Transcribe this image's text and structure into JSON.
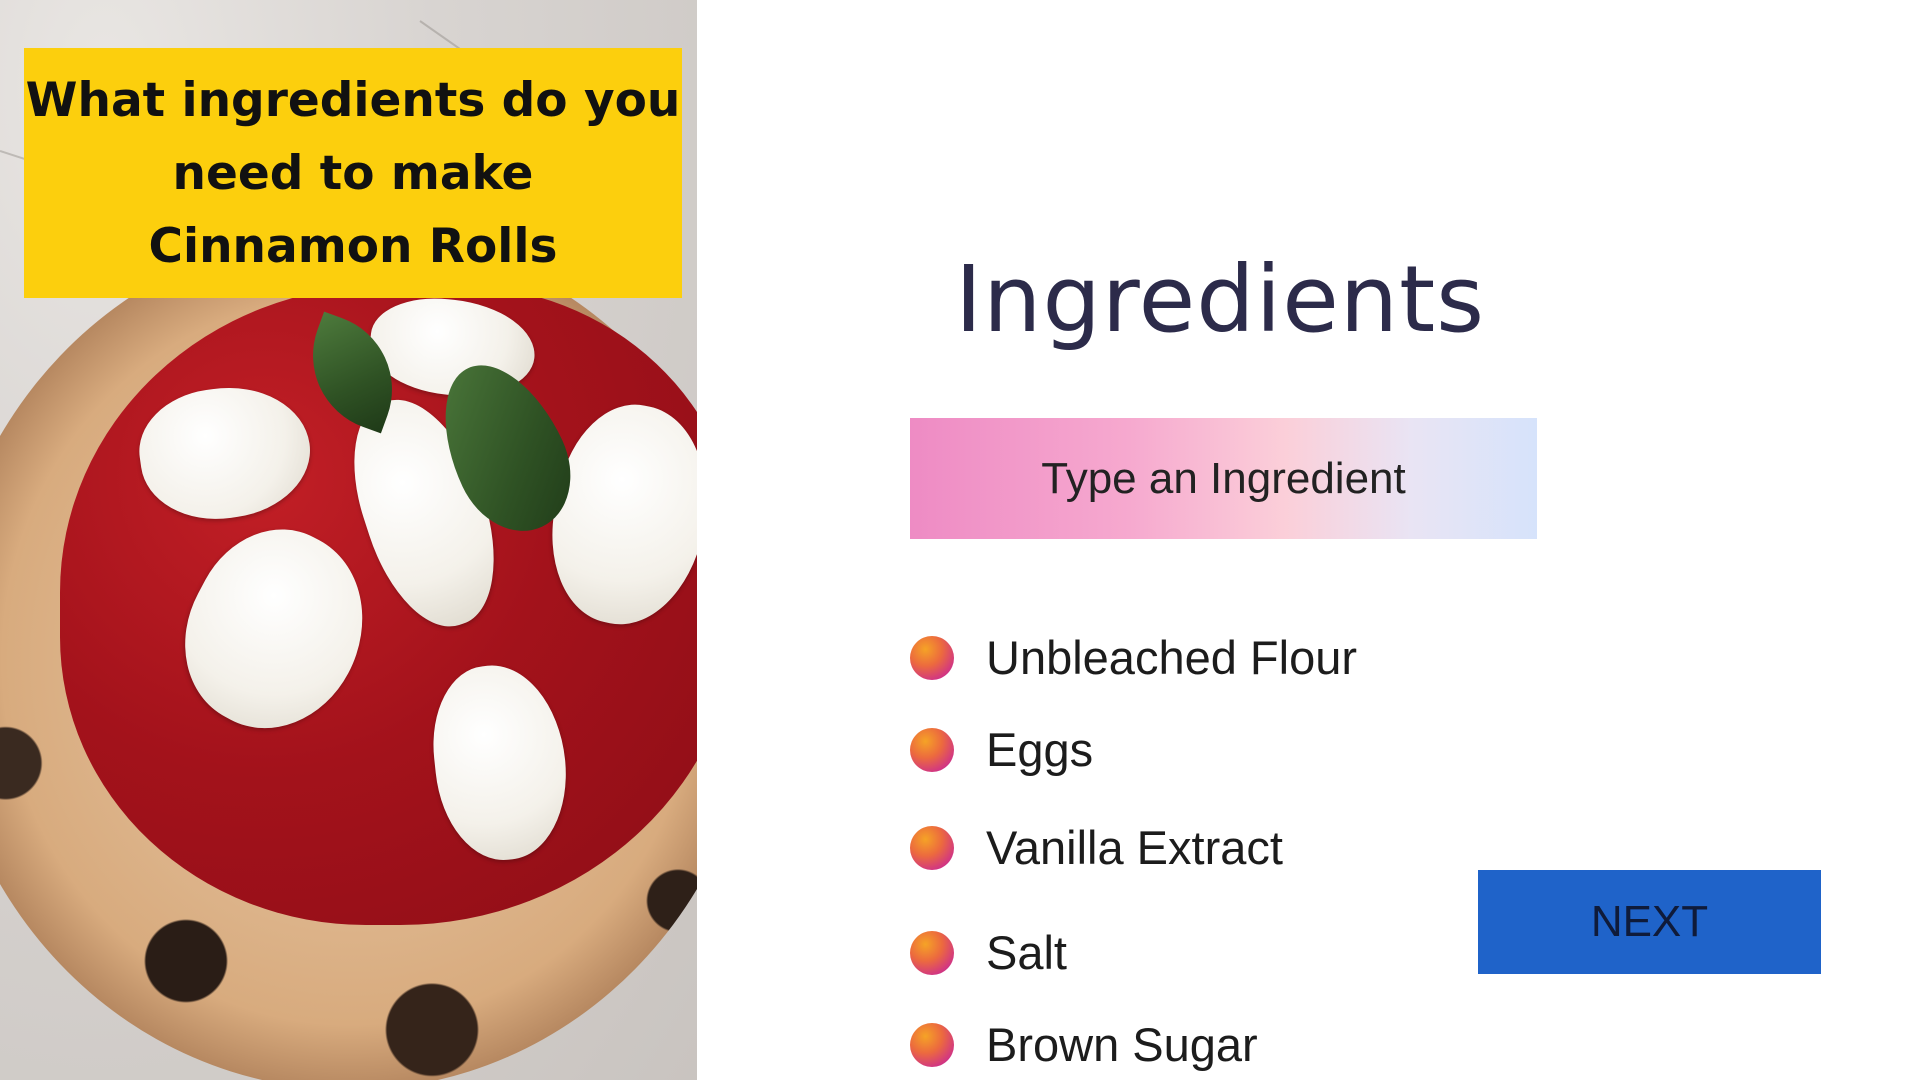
{
  "question_box": {
    "text": "What ingredients do you\nneed to make\nCinnamon Rolls",
    "background": "#fccf0d"
  },
  "heading": "Ingredients",
  "input": {
    "placeholder": "Type an Ingredient",
    "value": ""
  },
  "ingredients": [
    {
      "label": "Unbleached Flour",
      "icon": "gradient-dot-icon"
    },
    {
      "label": "Eggs",
      "icon": "gradient-dot-icon"
    },
    {
      "label": "Vanilla Extract",
      "icon": "gradient-dot-icon"
    },
    {
      "label": "Salt",
      "icon": "gradient-dot-icon"
    },
    {
      "label": "Brown Sugar",
      "icon": "gradient-dot-icon"
    }
  ],
  "next_button": {
    "label": "NEXT",
    "background": "#1f63c9"
  },
  "colors": {
    "heading": "#2c2b4a",
    "question_text": "#111111"
  }
}
